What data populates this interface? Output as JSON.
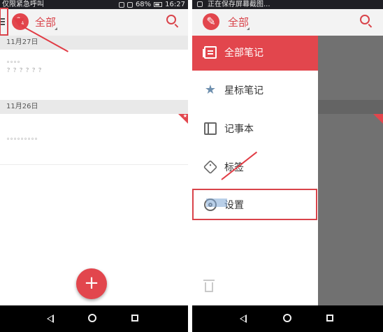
{
  "left_screen": {
    "status": {
      "carrier": "仅限紧急呼叫",
      "battery": "68%",
      "time": "16:27"
    },
    "app_bar": {
      "title": "全部",
      "logo_icon": "note-logo-icon",
      "search_icon": "search-icon",
      "menu_icon": "menu-icon"
    },
    "sections": [
      {
        "date": "11月27日",
        "notes": [
          {
            "line1": "。。。。",
            "line2": "？？？？？？"
          }
        ]
      },
      {
        "date": "11月26日",
        "notes": [
          {
            "line1": "。。。。。。。。。",
            "line2": ""
          }
        ]
      }
    ],
    "fab": {
      "label": "+"
    }
  },
  "right_screen": {
    "status": {
      "message": "正在保存屏幕截图..."
    },
    "app_bar": {
      "title": "全部"
    },
    "drawer": {
      "items": [
        {
          "label": "全部笔记",
          "icon": "notes-icon",
          "active": true
        },
        {
          "label": "星标笔记",
          "icon": "star-icon",
          "active": false
        },
        {
          "label": "记事本",
          "icon": "notebook-icon",
          "active": false
        },
        {
          "label": "标签",
          "icon": "tag-icon",
          "active": false
        },
        {
          "label": "设置",
          "icon": "settings-gear-icon",
          "active": false
        }
      ],
      "trash_icon": "trash-icon"
    }
  },
  "colors": {
    "accent": "#e2464d",
    "annotation": "#e13c45"
  }
}
